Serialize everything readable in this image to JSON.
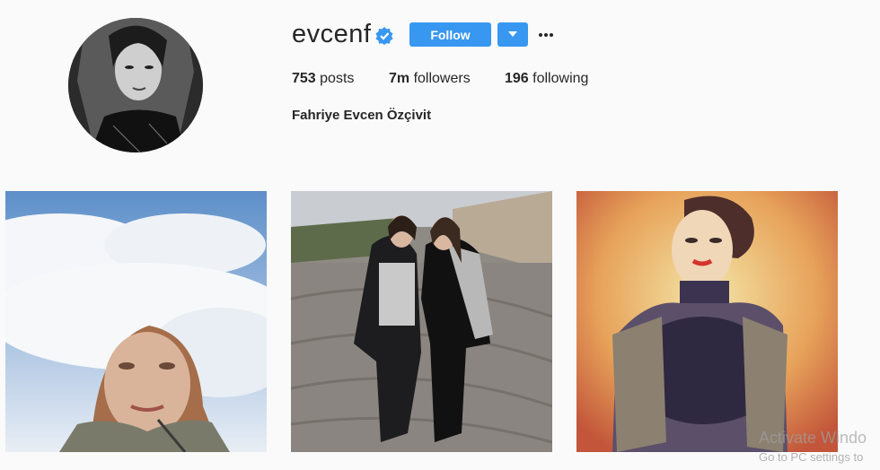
{
  "profile": {
    "username": "evcenf",
    "verified": true,
    "follow_label": "Follow",
    "full_name": "Fahriye Evcen Özçivit",
    "accent_color": "#3897f0"
  },
  "stats": {
    "posts_count": "753",
    "posts_label": "posts",
    "followers_count": "7m",
    "followers_label": "followers",
    "following_count": "196",
    "following_label": "following"
  },
  "posts": [
    {
      "kind": "selfie-sky"
    },
    {
      "kind": "two-friends-street"
    },
    {
      "kind": "portrait-drawing"
    }
  ],
  "watermark": {
    "line1": "Activate Windo",
    "line2": "Go to PC settings to"
  }
}
